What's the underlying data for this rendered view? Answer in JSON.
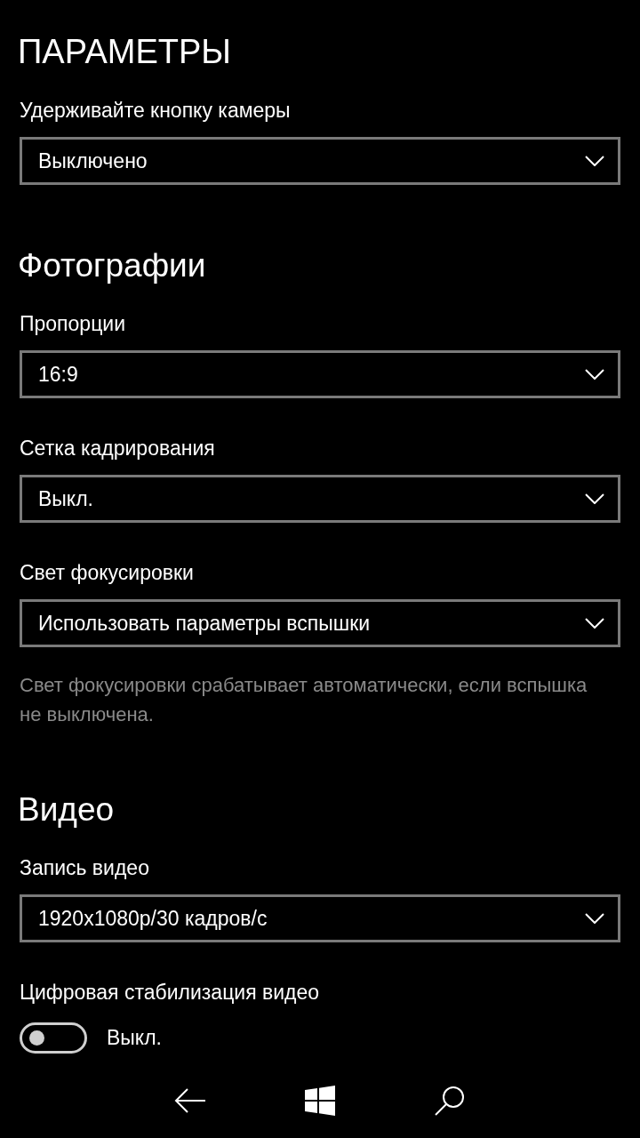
{
  "title": "ПАРАМЕТРЫ",
  "items": [
    {
      "kind": "dropdown",
      "label": "Удерживайте кнопку камеры",
      "value": "Выключено"
    },
    {
      "kind": "heading",
      "text": "Фотографии"
    },
    {
      "kind": "dropdown",
      "label": "Пропорции",
      "value": "16:9"
    },
    {
      "kind": "dropdown",
      "label": "Сетка кадрирования",
      "value": "Выкл."
    },
    {
      "kind": "dropdown",
      "label": "Свет фокусировки",
      "value": "Использовать параметры вспышки"
    },
    {
      "kind": "note",
      "text": "Свет фокусировки срабатывает автоматически, если вспышка не выключена."
    },
    {
      "kind": "heading",
      "text": "Видео"
    },
    {
      "kind": "dropdown",
      "label": "Запись видео",
      "value": "1920x1080p/30 кадров/с"
    },
    {
      "kind": "toggle",
      "label": "Цифровая стабилизация видео",
      "on": false,
      "state_label": "Выкл."
    }
  ]
}
